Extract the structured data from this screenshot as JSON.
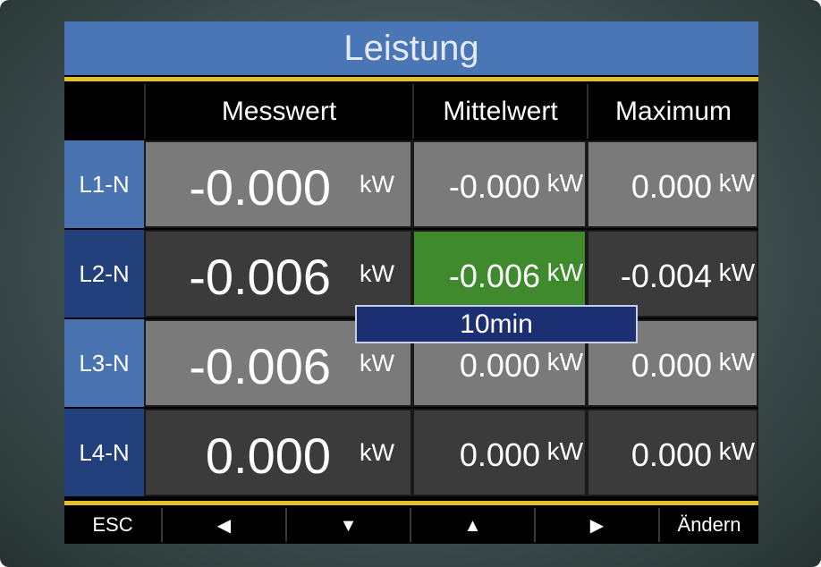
{
  "title": "Leistung",
  "columns": [
    "Messwert",
    "Mittelwert",
    "Maximum"
  ],
  "rows": [
    {
      "label": "L1-N",
      "messwert": "-0.000",
      "mittelwert": "-0.000",
      "maximum": "0.000",
      "unit": "kW"
    },
    {
      "label": "L2-N",
      "messwert": "-0.006",
      "mittelwert": "-0.006",
      "maximum": "-0.004",
      "unit": "kW"
    },
    {
      "label": "L3-N",
      "messwert": "-0.006",
      "mittelwert": "0.000",
      "maximum": "0.000",
      "unit": "kW"
    },
    {
      "label": "L4-N",
      "messwert": "0.000",
      "mittelwert": "0.000",
      "maximum": "0.000",
      "unit": "kW"
    }
  ],
  "popup": {
    "text": "10min"
  },
  "softkeys": [
    {
      "label": "ESC",
      "icon": ""
    },
    {
      "label": "",
      "icon": "arrow-left-icon"
    },
    {
      "label": "",
      "icon": "arrow-down-icon"
    },
    {
      "label": "",
      "icon": "arrow-up-icon"
    },
    {
      "label": "",
      "icon": "arrow-right-icon"
    },
    {
      "label": "Ändern",
      "icon": ""
    }
  ],
  "colors": {
    "title_bar": "#4b76b6",
    "accent_yellow": "#e2c228",
    "row_label_light": "#4a73b2",
    "row_label_dark": "#22407c",
    "cell_light": "#7a7a7a",
    "cell_dark": "#3b3b3b",
    "selected_cell": "#3e8a2c",
    "popup_background": "#1d2f73"
  }
}
